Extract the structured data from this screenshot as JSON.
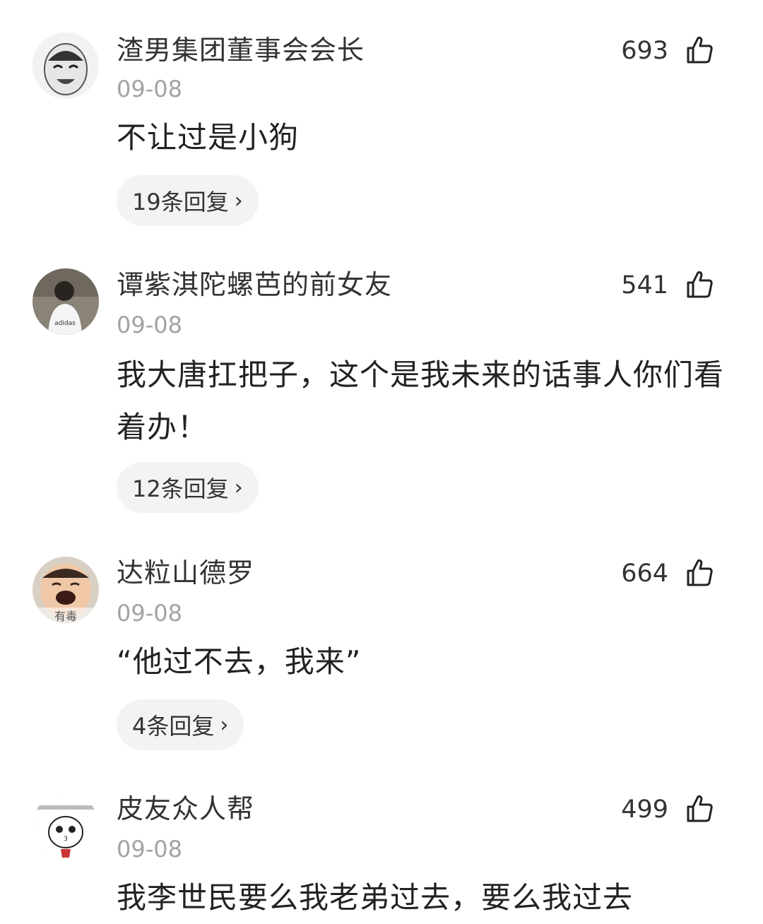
{
  "comments": [
    {
      "username": "渣男集团董事会会长",
      "date": "09-08",
      "likes": "693",
      "text": "不让过是小狗",
      "replies": "19条回复",
      "avatar_icon": "laughing-face-meme-avatar"
    },
    {
      "username": "谭紫淇陀螺芭的前女友",
      "date": "09-08",
      "likes": "541",
      "text": "我大唐扛把子，这个是我未来的话事人你们看着办！",
      "replies": "12条回复",
      "avatar_icon": "selfie-person-avatar"
    },
    {
      "username": "达粒山德罗",
      "date": "09-08",
      "likes": "664",
      "text": "“他过不去，我来”",
      "replies": "4条回复",
      "avatar_icon": "baby-face-avatar",
      "avatar_caption": "有毒"
    },
    {
      "username": "皮友众人帮",
      "date": "09-08",
      "likes": "499",
      "text": "我李世民要么我老弟过去，要么我过去",
      "avatar_icon": "cartoon-doodle-face-avatar"
    }
  ],
  "icons": {
    "like": "thumbs-up-icon",
    "chevron": "chevron-right-icon",
    "chevron_glyph": "›"
  },
  "colors": {
    "text": "#222222",
    "date": "#a3a3a3",
    "reply_bg": "#f3f3f3"
  }
}
